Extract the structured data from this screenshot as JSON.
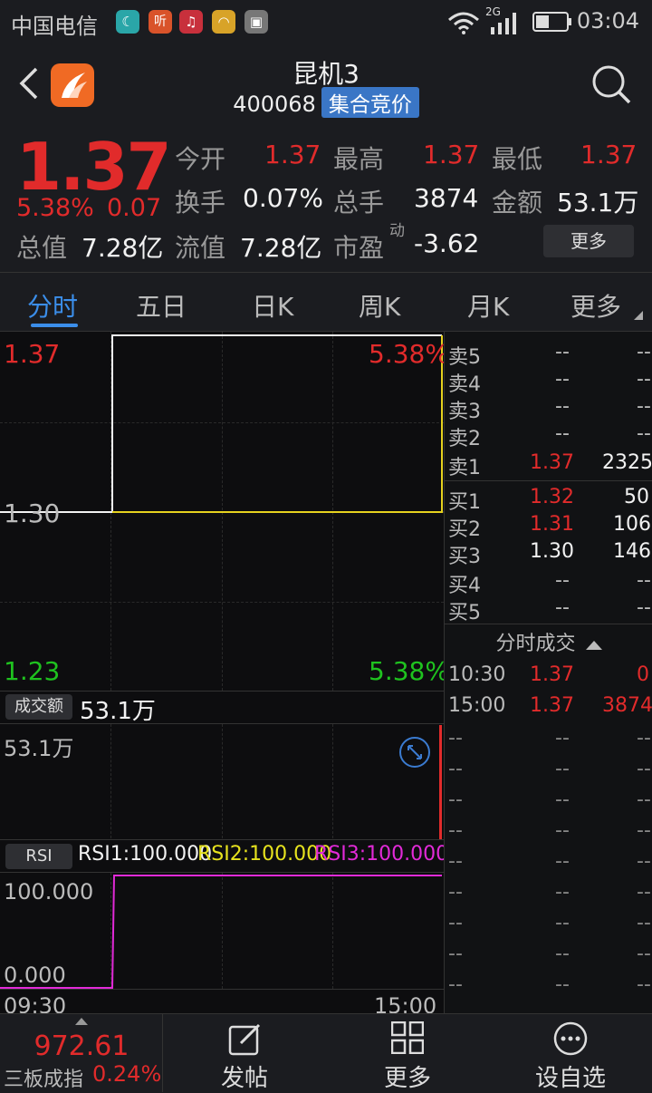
{
  "status": {
    "carrier": "中国电信",
    "icons": [
      "moon-app-icon",
      "ting-app-icon",
      "music-app-icon",
      "wifi-app-icon",
      "image-app-icon"
    ],
    "ting": "听",
    "network": "2G",
    "time": "03:04"
  },
  "header": {
    "name": "昆机3",
    "code": "400068",
    "badge": "集合竞价"
  },
  "quote": {
    "price": "1.37",
    "pct": "5.38%",
    "change": "0.07",
    "open_label": "今开",
    "open": "1.37",
    "high_label": "最高",
    "high": "1.37",
    "low_label": "最低",
    "low": "1.37",
    "turnover_label": "换手",
    "turnover": "0.07%",
    "vol_label": "总手",
    "vol": "3874",
    "amount_label": "金额",
    "amount": "53.1万",
    "mcap_label": "总值",
    "mcap": "7.28亿",
    "float_label": "流值",
    "float": "7.28亿",
    "pe_label": "市盈",
    "pe_sup": "动",
    "pe": "-3.62",
    "more": "更多"
  },
  "tabs": [
    "分时",
    "五日",
    "日K",
    "周K",
    "月K",
    "更多"
  ],
  "chart": {
    "y_top": "1.37",
    "y_mid": "1.30",
    "y_bot": "1.23",
    "pct_top": "5.38%",
    "pct_bot": "5.38%",
    "vol_btn": "成交额",
    "vol_value": "53.1万",
    "vol_axis": "53.1万",
    "rsi_btn": "RSI",
    "rsi1": "RSI1:100.000",
    "rsi2": "RSI2:100.000",
    "rsi3": "RSI3:100.000",
    "rsi_top": "100.000",
    "rsi_bot": "0.000",
    "t_start": "09:30",
    "t_end": "15:00"
  },
  "book": {
    "asks": [
      {
        "label": "卖5",
        "price": "--",
        "vol": "--"
      },
      {
        "label": "卖4",
        "price": "--",
        "vol": "--"
      },
      {
        "label": "卖3",
        "price": "--",
        "vol": "--"
      },
      {
        "label": "卖2",
        "price": "--",
        "vol": "--"
      },
      {
        "label": "卖1",
        "price": "1.37",
        "vol": "2325"
      }
    ],
    "bids": [
      {
        "label": "买1",
        "price": "1.32",
        "vol": "50"
      },
      {
        "label": "买2",
        "price": "1.31",
        "vol": "106"
      },
      {
        "label": "买3",
        "price": "1.30",
        "vol": "146"
      },
      {
        "label": "买4",
        "price": "--",
        "vol": "--"
      },
      {
        "label": "买5",
        "price": "--",
        "vol": "--"
      }
    ],
    "trades_header": "分时成交",
    "trades": [
      {
        "time": "10:30",
        "price": "1.37",
        "vol": "0"
      },
      {
        "time": "15:00",
        "price": "1.37",
        "vol": "3874"
      }
    ],
    "empty": "--"
  },
  "bottom": {
    "index_value": "972.61",
    "index_name": "三板成指",
    "index_pct": "0.24%",
    "post": "发帖",
    "more": "更多",
    "watch": "设自选"
  }
}
